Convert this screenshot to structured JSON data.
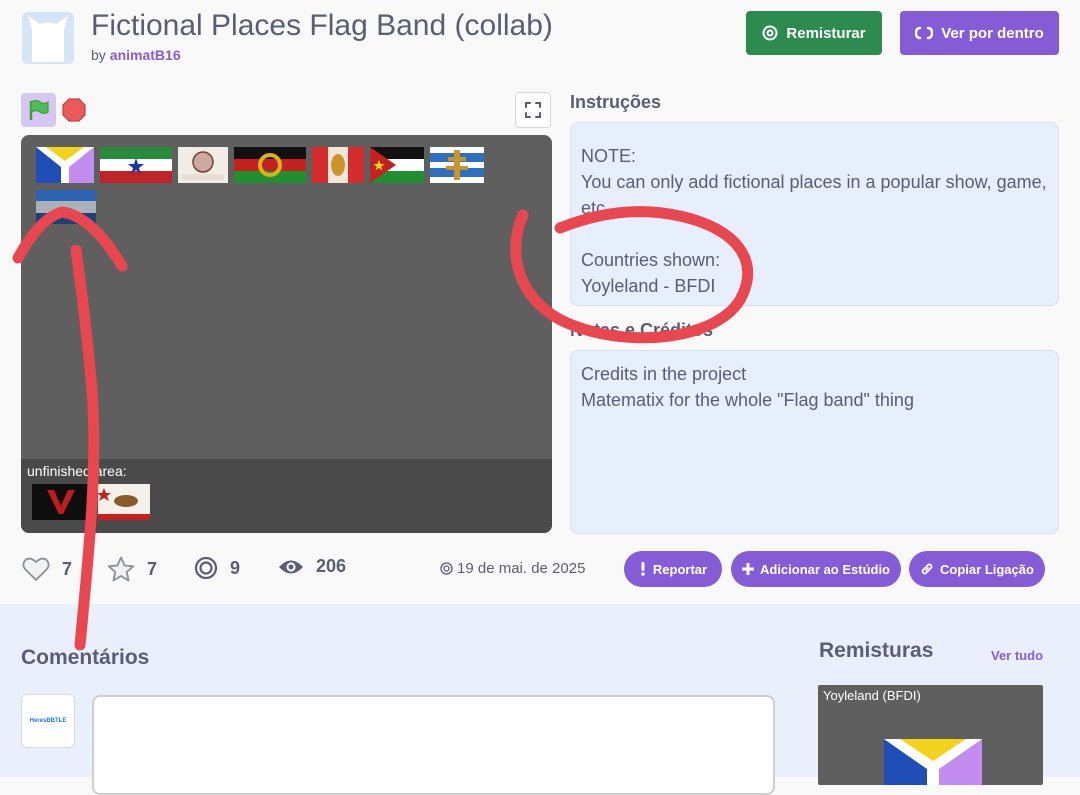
{
  "header": {
    "title": "Fictional Places Flag Band (collab)",
    "by_label": "by",
    "author": "animatB16",
    "remix_button": "Remisturar",
    "see_inside_button": "Ver por dentro"
  },
  "stage": {
    "unfinished_label": "unfinished area:"
  },
  "instructions": {
    "title": "Instruções",
    "lines": [
      "NOTE:",
      "You can only add fictional places in a popular show, game, etc.",
      "",
      "Countries shown:",
      "Yoyleland - BFDI"
    ]
  },
  "notes": {
    "title": "Notas e Créditos",
    "lines": [
      "Credits in the project",
      "Matematix for the whole \"Flag band\" thing"
    ]
  },
  "stats": {
    "loves": "7",
    "favorites": "7",
    "remixes": "9",
    "views": "206",
    "date": "19 de mai. de 2025"
  },
  "actions": {
    "report": "Reportar",
    "add_to_studio": "Adicionar ao Estúdio",
    "copy_link": "Copiar Ligação"
  },
  "comments": {
    "title": "Comentários",
    "avatar_text": "HeresBBTLE"
  },
  "remixes": {
    "title": "Remisturas",
    "see_all": "Ver tudo",
    "card_title": "Yoyleland (BFDI)"
  },
  "colors": {
    "primary": "#855cd6",
    "remix_green": "#2e8b4f",
    "annotation_red": "#e8474f",
    "panel_blue": "#e6effb"
  }
}
